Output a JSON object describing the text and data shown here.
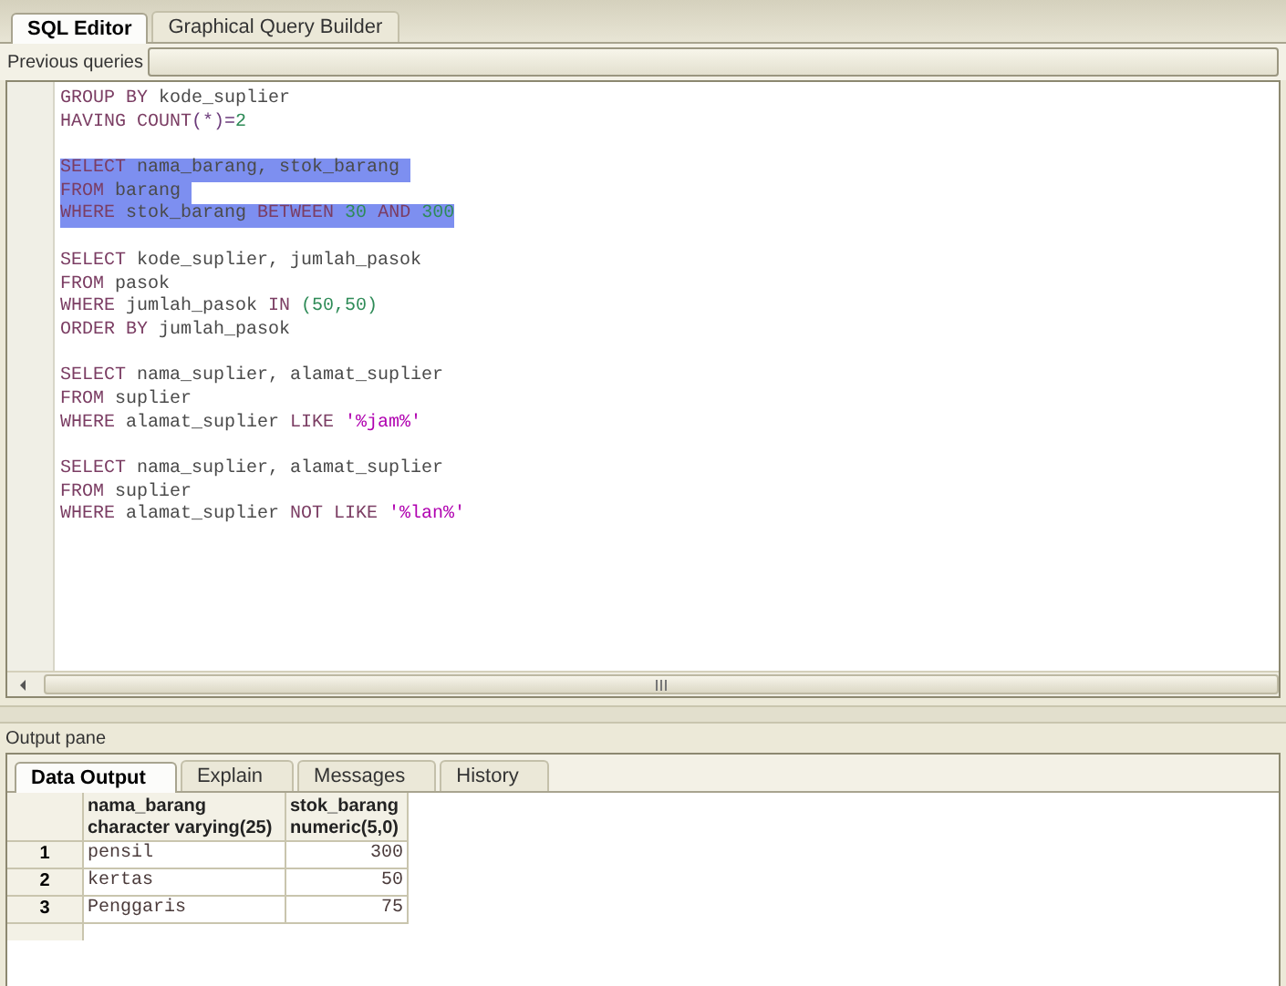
{
  "editor_tabs": [
    {
      "label": "SQL Editor",
      "selected": true
    },
    {
      "label": "Graphical Query Builder",
      "selected": false
    }
  ],
  "previous_queries": {
    "label": "Previous queries"
  },
  "queries": [
    {
      "selected": false,
      "lines": [
        [
          {
            "kind": "keyword",
            "text": "GROUP BY"
          },
          {
            "kind": "ident",
            "text": " kode_suplier"
          }
        ],
        [
          {
            "kind": "keyword",
            "text": "HAVING COUNT"
          },
          {
            "kind": "operator",
            "text": "(*)="
          },
          {
            "kind": "number",
            "text": "2"
          }
        ]
      ]
    },
    {
      "selected": true,
      "lines": [
        [
          {
            "kind": "keyword",
            "text": "SELECT"
          },
          {
            "kind": "ident",
            "text": " nama_barang, stok_barang "
          }
        ],
        [
          {
            "kind": "keyword",
            "text": "FROM"
          },
          {
            "kind": "ident",
            "text": " barang "
          }
        ],
        [
          {
            "kind": "keyword",
            "text": "WHERE"
          },
          {
            "kind": "ident",
            "text": " stok_barang "
          },
          {
            "kind": "keyword",
            "text": "BETWEEN"
          },
          {
            "kind": "number",
            "text": " 30 "
          },
          {
            "kind": "keyword",
            "text": "AND"
          },
          {
            "kind": "number",
            "text": " 300"
          }
        ]
      ]
    },
    {
      "selected": false,
      "lines": [
        [
          {
            "kind": "keyword",
            "text": "SELECT"
          },
          {
            "kind": "ident",
            "text": " kode_suplier, jumlah_pasok"
          }
        ],
        [
          {
            "kind": "keyword",
            "text": "FROM"
          },
          {
            "kind": "ident",
            "text": " pasok"
          }
        ],
        [
          {
            "kind": "keyword",
            "text": "WHERE"
          },
          {
            "kind": "ident",
            "text": " jumlah_pasok "
          },
          {
            "kind": "keyword",
            "text": "IN"
          },
          {
            "kind": "number",
            "text": " (50,50)"
          }
        ],
        [
          {
            "kind": "keyword",
            "text": "ORDER BY"
          },
          {
            "kind": "ident",
            "text": " jumlah_pasok"
          }
        ]
      ]
    },
    {
      "selected": false,
      "lines": [
        [
          {
            "kind": "keyword",
            "text": "SELECT"
          },
          {
            "kind": "ident",
            "text": " nama_suplier, alamat_suplier"
          }
        ],
        [
          {
            "kind": "keyword",
            "text": "FROM"
          },
          {
            "kind": "ident",
            "text": " suplier"
          }
        ],
        [
          {
            "kind": "keyword",
            "text": "WHERE"
          },
          {
            "kind": "ident",
            "text": " alamat_suplier "
          },
          {
            "kind": "keyword",
            "text": "LIKE"
          },
          {
            "kind": "string",
            "text": " '%jam%'"
          }
        ]
      ]
    },
    {
      "selected": false,
      "lines": [
        [
          {
            "kind": "keyword",
            "text": "SELECT"
          },
          {
            "kind": "ident",
            "text": " nama_suplier, alamat_suplier"
          }
        ],
        [
          {
            "kind": "keyword",
            "text": "FROM"
          },
          {
            "kind": "ident",
            "text": " suplier"
          }
        ],
        [
          {
            "kind": "keyword",
            "text": "WHERE"
          },
          {
            "kind": "ident",
            "text": " alamat_suplier "
          },
          {
            "kind": "keyword",
            "text": "NOT LIKE"
          },
          {
            "kind": "string",
            "text": " '%lan%'"
          }
        ]
      ]
    }
  ],
  "output_pane": {
    "label": "Output pane"
  },
  "output_tabs": [
    {
      "label": "Data Output",
      "selected": true
    },
    {
      "label": "Explain",
      "selected": false
    },
    {
      "label": "Messages",
      "selected": false
    },
    {
      "label": "History",
      "selected": false
    }
  ],
  "table": {
    "columns": [
      {
        "name": "nama_barang",
        "type": "character varying(25)",
        "kind": "text"
      },
      {
        "name": "stok_barang",
        "type": "numeric(5,0)",
        "kind": "numeric"
      }
    ],
    "rows": [
      {
        "number": "1",
        "cells": [
          "pensil",
          "300"
        ]
      },
      {
        "number": "2",
        "cells": [
          "kertas",
          "50"
        ]
      },
      {
        "number": "3",
        "cells": [
          "Penggaris",
          "75"
        ]
      }
    ]
  }
}
